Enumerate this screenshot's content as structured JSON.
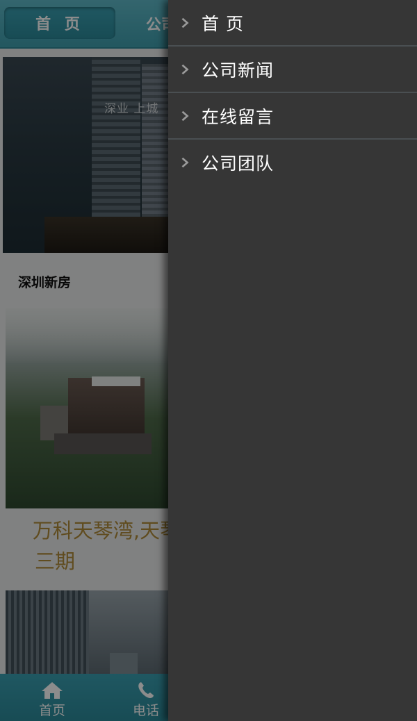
{
  "top_nav": {
    "tab_home_label": "首 页",
    "tab_company_label": "公司"
  },
  "content": {
    "section_label": "深圳新房",
    "hero_logo_text": "深业 上城",
    "property_caption_line1": "万科天琴湾,天琴",
    "property_caption_line2": "三期"
  },
  "bottom_bar": {
    "home_label": "首页",
    "phone_label": "电话",
    "home_icon": "home-icon",
    "phone_icon": "phone-icon"
  },
  "drawer": {
    "items": [
      {
        "label": "首 页",
        "icon": "chevron-right-icon"
      },
      {
        "label": "公司新闻",
        "icon": "chevron-right-icon"
      },
      {
        "label": "在线留言",
        "icon": "chevron-right-icon"
      },
      {
        "label": "公司团队",
        "icon": "chevron-right-icon"
      }
    ]
  },
  "colors": {
    "nav_teal": "#3f9fae",
    "drawer_bg": "#363636",
    "caption_gold": "#b08a3a"
  }
}
